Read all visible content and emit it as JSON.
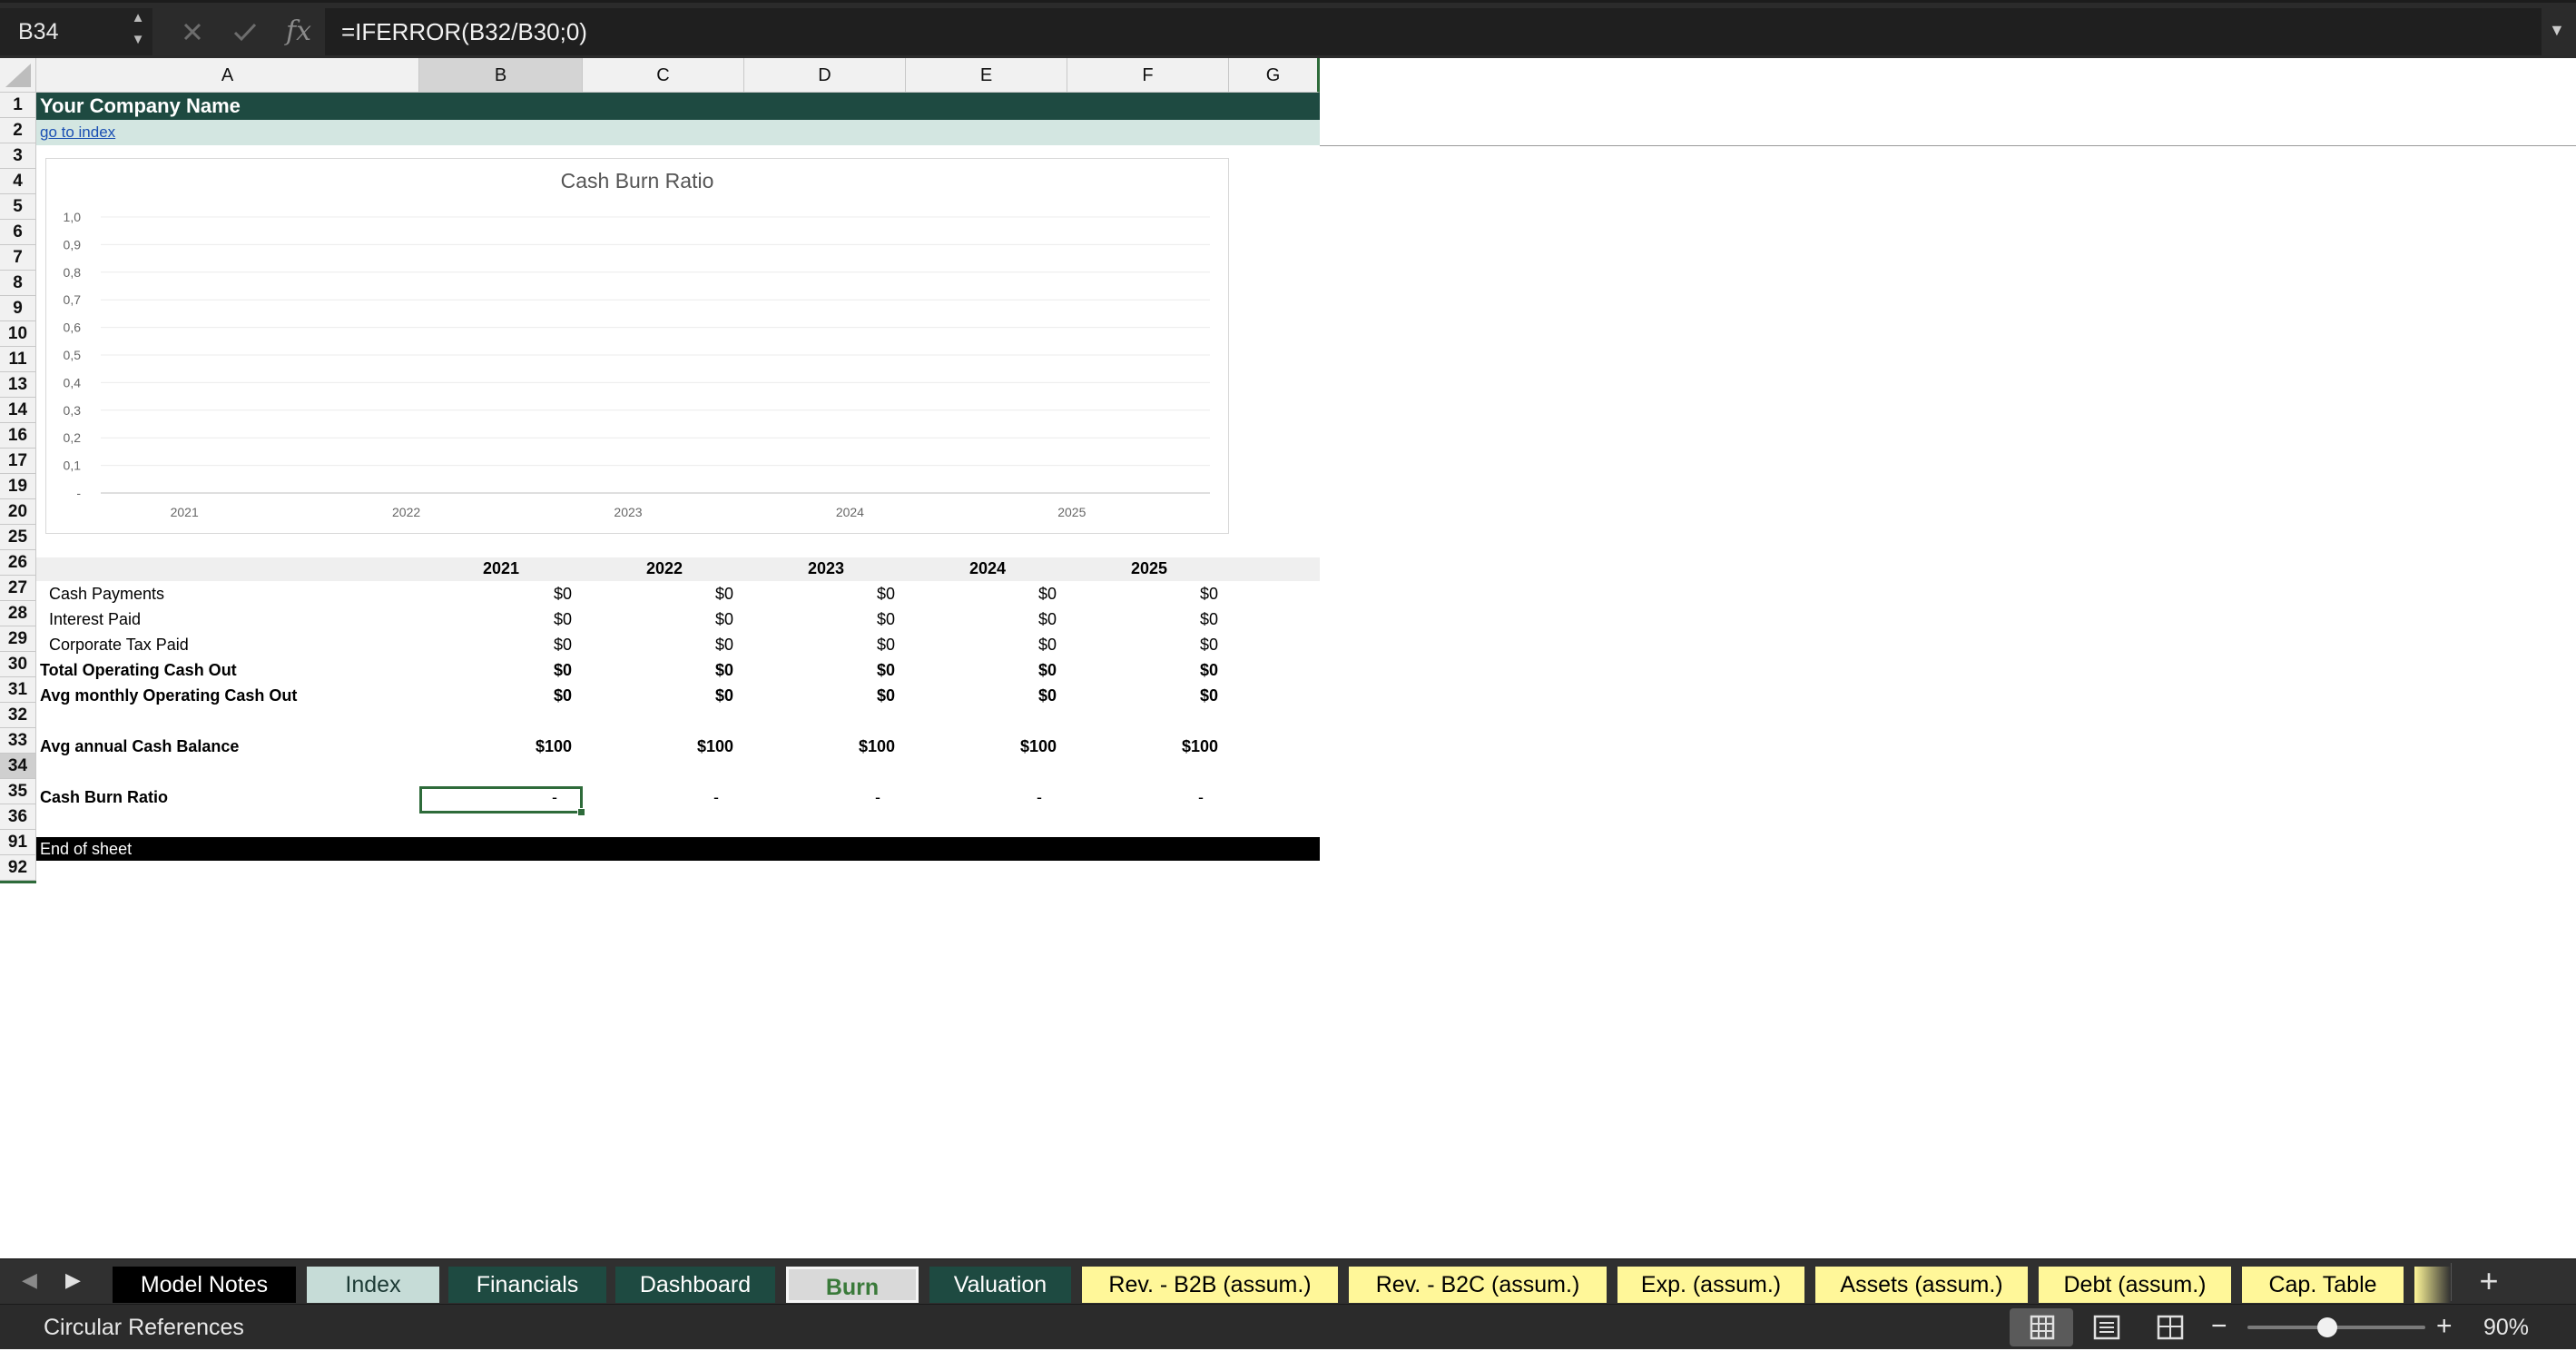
{
  "formula_bar": {
    "cell_ref": "B34",
    "cancel_icon": "cross-icon",
    "confirm_icon": "check-icon",
    "fx_label": "fx",
    "formula": "=IFERROR(B32/B30;0)"
  },
  "columns": [
    "A",
    "B",
    "C",
    "D",
    "E",
    "F",
    "G"
  ],
  "rows": [
    "1",
    "2",
    "3",
    "4",
    "5",
    "6",
    "7",
    "8",
    "9",
    "10",
    "11",
    "13",
    "14",
    "16",
    "17",
    "19",
    "20",
    "25",
    "26",
    "27",
    "28",
    "29",
    "30",
    "31",
    "32",
    "33",
    "34",
    "35",
    "36",
    "91",
    "92"
  ],
  "sheet": {
    "company_name": "Your Company Name",
    "index_link": "go to index",
    "years": [
      "2021",
      "2022",
      "2023",
      "2024",
      "2025"
    ],
    "table_rows": [
      {
        "label": "Cash Payments",
        "values": [
          "$0",
          "$0",
          "$0",
          "$0",
          "$0"
        ]
      },
      {
        "label": "Interest Paid",
        "values": [
          "$0",
          "$0",
          "$0",
          "$0",
          "$0"
        ]
      },
      {
        "label": "Corporate Tax Paid",
        "values": [
          "$0",
          "$0",
          "$0",
          "$0",
          "$0"
        ]
      },
      {
        "label": "Total Operating Cash Out",
        "values": [
          "$0",
          "$0",
          "$0",
          "$0",
          "$0"
        ]
      },
      {
        "label": "Avg monthly Operating Cash Out",
        "values": [
          "$0",
          "$0",
          "$0",
          "$0",
          "$0"
        ]
      },
      {
        "label": "Avg annual Cash Balance",
        "values": [
          "$100",
          "$100",
          "$100",
          "$100",
          "$100"
        ]
      },
      {
        "label": "Cash Burn Ratio",
        "values": [
          "-",
          "-",
          "-",
          "-",
          "-"
        ]
      }
    ],
    "end_label": "End of sheet"
  },
  "chart_data": {
    "type": "line",
    "title": "Cash Burn Ratio",
    "categories": [
      "2021",
      "2022",
      "2023",
      "2024",
      "2025"
    ],
    "y_ticks": [
      "1,0",
      "0,9",
      "0,8",
      "0,7",
      "0,6",
      "0,5",
      "0,4",
      "0,3",
      "0,2",
      "0,1",
      "-"
    ],
    "ylim": [
      0,
      1
    ],
    "series": [
      {
        "values": [
          0,
          0,
          0,
          0,
          0
        ]
      }
    ],
    "grid": true
  },
  "tabs": [
    {
      "label": "Model Notes",
      "bg": "#000000",
      "fg": "#ffffff"
    },
    {
      "label": "Index",
      "bg": "#c6dcd7",
      "fg": "#1c3a35"
    },
    {
      "label": "Financials",
      "bg": "#1e4a41",
      "fg": "#ffffff"
    },
    {
      "label": "Dashboard",
      "bg": "#1e4a41",
      "fg": "#ffffff"
    },
    {
      "label": "Burn",
      "bg": "#d9d9d9",
      "fg": "#3a7a3a"
    },
    {
      "label": "Valuation",
      "bg": "#1e4a41",
      "fg": "#ffffff"
    },
    {
      "label": "Rev. - B2B (assum.)",
      "bg": "#fff799",
      "fg": "#000000"
    },
    {
      "label": "Rev. - B2C (assum.)",
      "bg": "#fff799",
      "fg": "#000000"
    },
    {
      "label": "Exp. (assum.)",
      "bg": "#fff799",
      "fg": "#000000"
    },
    {
      "label": "Assets (assum.)",
      "bg": "#fff799",
      "fg": "#000000"
    },
    {
      "label": "Debt (assum.)",
      "bg": "#fff799",
      "fg": "#000000"
    },
    {
      "label": "Cap. Table",
      "bg": "#fff799",
      "fg": "#000000"
    }
  ],
  "tab_nav": {
    "prev": "◀",
    "next": "▶",
    "add": "+"
  },
  "status": {
    "message": "Circular References",
    "zoom": "90%",
    "zoom_fraction": 0.45,
    "zoom_minus": "−",
    "zoom_plus": "+"
  },
  "colors": {
    "header_band": "#1e4a41",
    "link_band": "#d3e6e1",
    "selection": "#2e6b3a"
  }
}
